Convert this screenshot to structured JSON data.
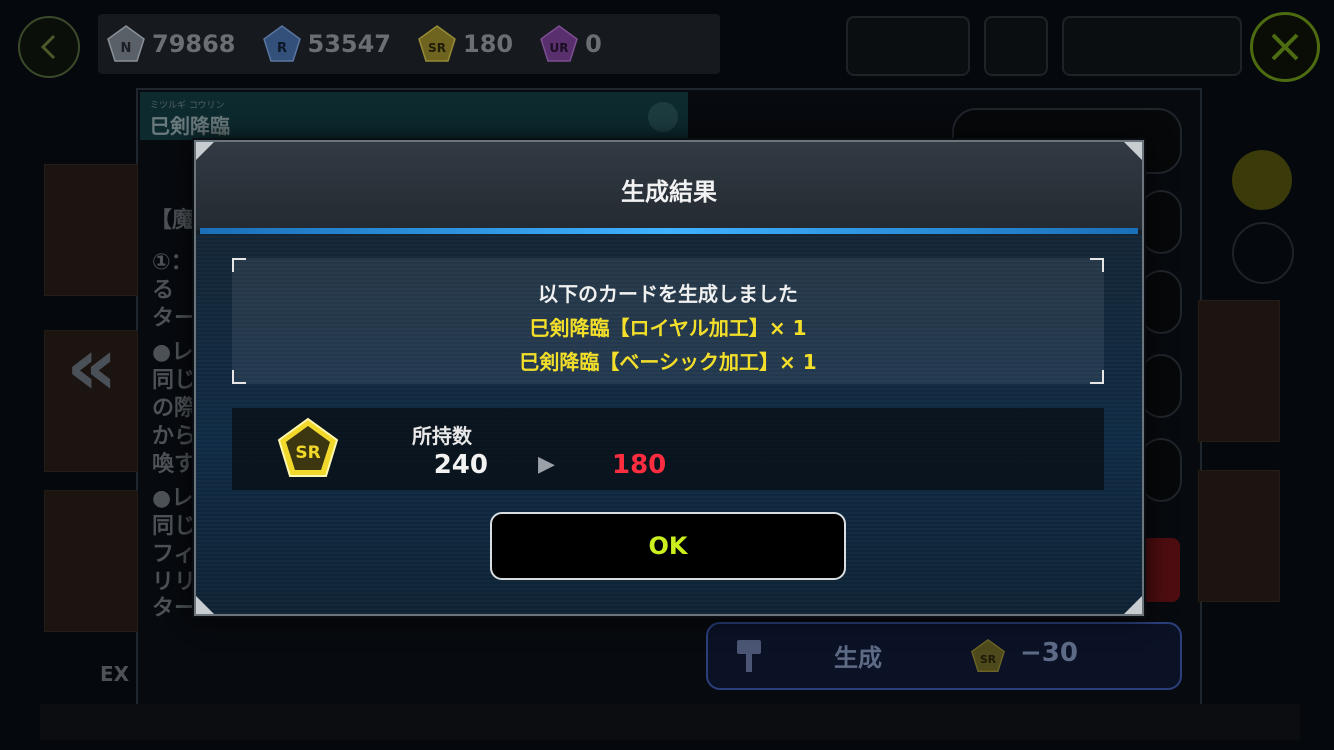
{
  "header": {
    "cp_counts": [
      {
        "rarity": "N",
        "value": "79868",
        "color": "#5a6068"
      },
      {
        "rarity": "R",
        "value": "53547",
        "color": "#33507a"
      },
      {
        "rarity": "SR",
        "value": "180",
        "color": "#6e6420"
      },
      {
        "rarity": "UR",
        "value": "0",
        "color": "#5a2f6e"
      }
    ],
    "back_icon": "back-arrow-icon",
    "close_icon": "close-x-icon"
  },
  "card": {
    "ruby": "ミツルギ コウリン",
    "name": "巳剣降臨",
    "attribute_icon": "attribute-icon",
    "text_fragments": [
      "【魔",
      "①：",
      "る",
      "ター",
      "●レ",
      "同じ",
      "の際",
      "から",
      "喚す",
      "●レ",
      "同じ",
      "フィ",
      "リリ",
      "ター"
    ],
    "bottom_tag": "EX"
  },
  "generate_button": {
    "label": "生成",
    "cost": "−30",
    "cost_rarity": "SR"
  },
  "modal": {
    "title": "生成結果",
    "message": "以下のカードを生成しました",
    "items": [
      "巳剣降臨【ロイヤル加工】× 1",
      "巳剣降臨【ベーシック加工】× 1"
    ],
    "item_color": "#f3df2a",
    "owned": {
      "label": "所持数",
      "rarity_badge": "SR",
      "before": "240",
      "after": "180",
      "after_color": "#ff2d3f"
    },
    "ok_label": "OK",
    "ok_color": "#c9f01e"
  }
}
